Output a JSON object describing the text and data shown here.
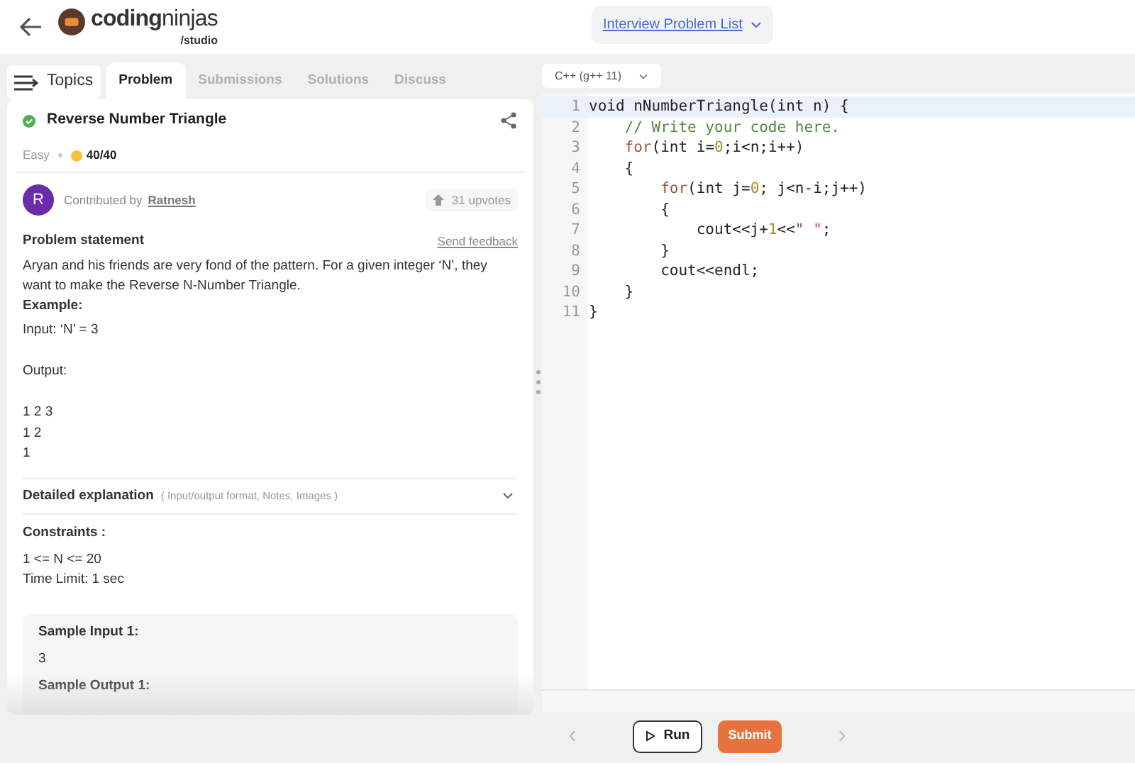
{
  "header": {
    "brand_bold": "coding",
    "brand_light": "ninjas",
    "brand_sub": "/studio",
    "list_link": "Interview Problem List"
  },
  "tabs": [
    {
      "label": "Problem",
      "selected": true
    },
    {
      "label": "Submissions",
      "selected": false
    },
    {
      "label": "Solutions",
      "selected": false
    },
    {
      "label": "Discuss",
      "selected": false
    }
  ],
  "topics_button": "Topics",
  "problem": {
    "title": "Reverse Number Triangle",
    "solved": true,
    "difficulty": "Easy",
    "score": "40/40",
    "contributed_by": "Contributed by",
    "author": "Ratnesh",
    "author_initial": "R",
    "upvotes": "31 upvotes",
    "statement_heading": "Problem statement",
    "feedback_link": "Send feedback",
    "statement": "Aryan and his friends are very fond of the pattern. For a given integer ‘N’, they want to make the Reverse N-Number Triangle.",
    "example_heading": "Example:",
    "example_input": "Input: ‘N’ = 3",
    "example_output_heading": "Output:",
    "example_output": [
      "1 2 3",
      "1 2",
      "1"
    ],
    "explanation_heading": "Detailed explanation",
    "explanation_hint": "( Input/output format, Notes, Images )",
    "constraints_heading": "Constraints :",
    "constraints_lines": [
      "1  <= N <= 20",
      "Time Limit: 1 sec"
    ],
    "sample_input_heading": "Sample Input 1:",
    "sample_input": "3",
    "sample_output_heading": "Sample Output 1:"
  },
  "editor": {
    "language": "C++ (g++ 11)",
    "lines": [
      {
        "number": "1",
        "current": true,
        "tokens": [
          {
            "kind": "plain",
            "text": "void nNumberTriangle(int n) {"
          }
        ]
      },
      {
        "number": "2",
        "current": false,
        "tokens": [
          {
            "kind": "comment",
            "text": "    // Write your code here."
          }
        ]
      },
      {
        "number": "3",
        "current": false,
        "tokens": [
          {
            "kind": "keyword",
            "text": "    for"
          },
          {
            "kind": "plain",
            "text": "(int i="
          },
          {
            "kind": "number",
            "text": "0"
          },
          {
            "kind": "plain",
            "text": ";i<n;i++)"
          }
        ]
      },
      {
        "number": "4",
        "current": false,
        "tokens": [
          {
            "kind": "plain",
            "text": "    {"
          }
        ]
      },
      {
        "number": "5",
        "current": false,
        "tokens": [
          {
            "kind": "keyword",
            "text": "        for"
          },
          {
            "kind": "plain",
            "text": "(int j="
          },
          {
            "kind": "number",
            "text": "0"
          },
          {
            "kind": "plain",
            "text": "; j<n-i;j++)"
          }
        ]
      },
      {
        "number": "6",
        "current": false,
        "tokens": [
          {
            "kind": "plain",
            "text": "        {"
          }
        ]
      },
      {
        "number": "7",
        "current": false,
        "tokens": [
          {
            "kind": "plain",
            "text": "            cout<<j+"
          },
          {
            "kind": "number",
            "text": "1"
          },
          {
            "kind": "plain",
            "text": "<<"
          },
          {
            "kind": "string",
            "text": "\" \""
          },
          {
            "kind": "plain",
            "text": ";"
          }
        ]
      },
      {
        "number": "8",
        "current": false,
        "tokens": [
          {
            "kind": "plain",
            "text": "        }"
          }
        ]
      },
      {
        "number": "9",
        "current": false,
        "tokens": [
          {
            "kind": "plain",
            "text": "        cout<<endl;"
          }
        ]
      },
      {
        "number": "10",
        "current": false,
        "tokens": [
          {
            "kind": "plain",
            "text": "    }"
          }
        ]
      },
      {
        "number": "11",
        "current": false,
        "tokens": [
          {
            "kind": "plain",
            "text": "}"
          }
        ]
      }
    ]
  },
  "actions": {
    "run": "Run",
    "submit": "Submit"
  }
}
